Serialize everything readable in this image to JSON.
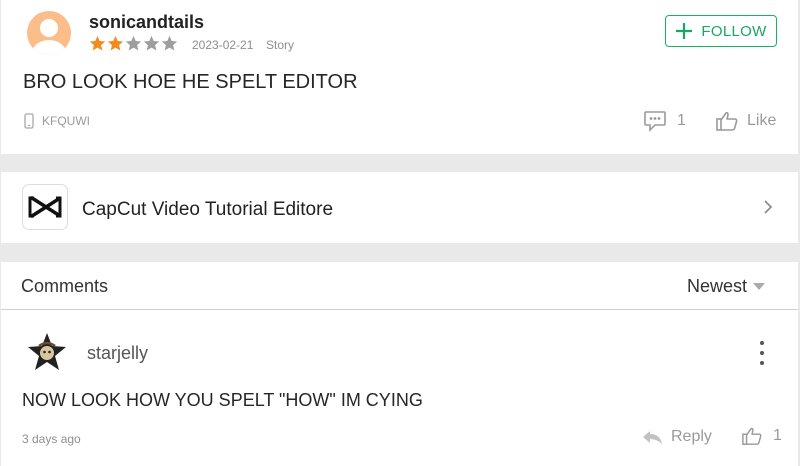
{
  "review": {
    "username": "sonicandtails",
    "rating": 2,
    "rating_max": 5,
    "date": "2023-02-21",
    "category": "Story",
    "follow_label": "FOLLOW",
    "text": "BRO LOOK HOE HE SPELT EDITOR",
    "device": "KFQUWI",
    "comment_count": "1",
    "like_label": "Like"
  },
  "app": {
    "name": "CapCut Video Tutorial Editore"
  },
  "comments": {
    "title": "Comments",
    "sort_label": "Newest",
    "items": [
      {
        "username": "starjelly",
        "text": "NOW LOOK HOW YOU SPELT \"HOW\" IM CYING",
        "time": "3 days ago",
        "reply_label": "Reply",
        "likes": "1"
      }
    ]
  },
  "colors": {
    "accent_green": "#17b26a",
    "star_filled": "#f28c1e",
    "star_empty": "#9e9e9e",
    "avatar_bg": "#fbbd8a"
  }
}
